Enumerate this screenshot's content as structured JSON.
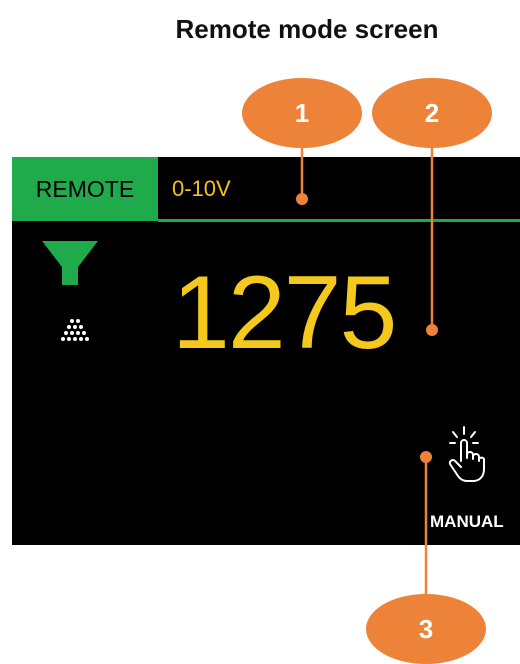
{
  "title": "Remote mode screen",
  "screen": {
    "mode_label": "REMOTE",
    "signal_label": "0-10V",
    "speed_value": "1275",
    "manual_label": "MANUAL"
  },
  "callouts": [
    "1",
    "2",
    "3"
  ],
  "colors": {
    "accent_green": "#1faa4b",
    "value_yellow": "#f4c81c",
    "callout_orange": "#ed8239",
    "screen_bg": "#000000"
  },
  "icons": [
    "funnel-icon",
    "dots-icon",
    "hand-tap-icon"
  ]
}
